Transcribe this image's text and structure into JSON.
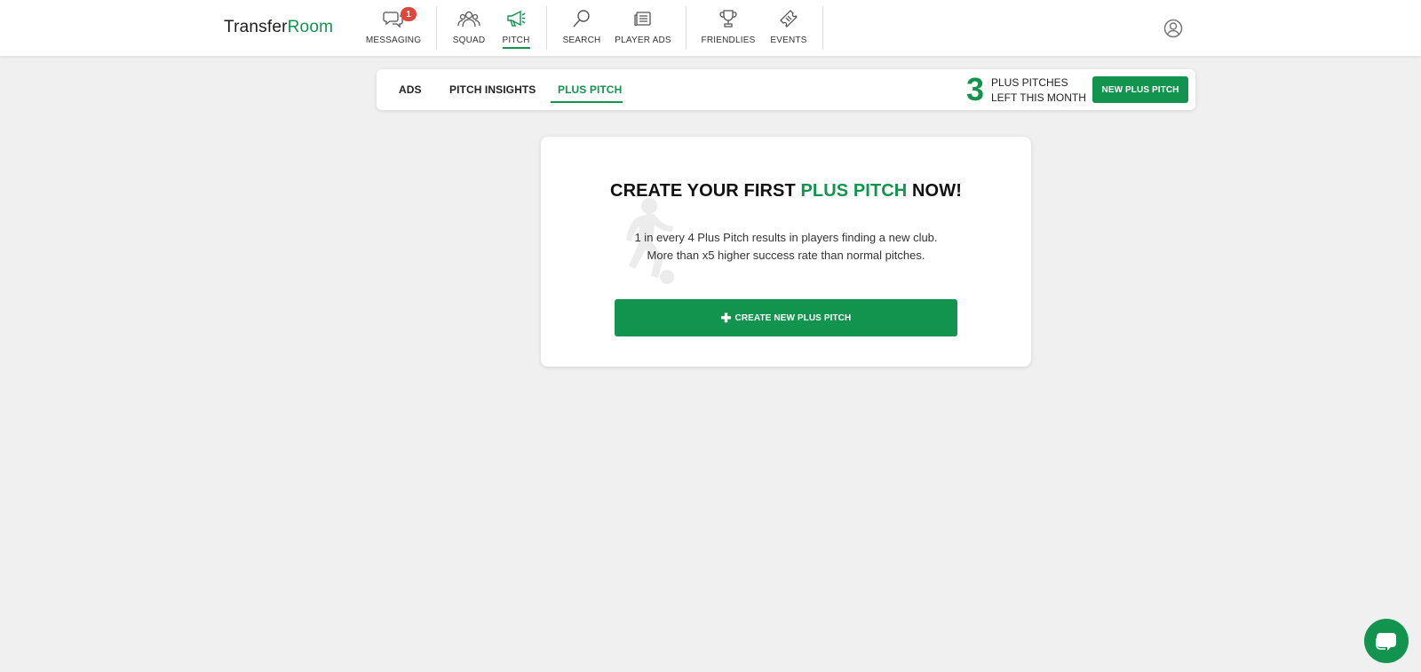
{
  "logo": {
    "part1": "Transfer",
    "part2": "Room"
  },
  "nav": {
    "messaging": "MESSAGING",
    "messaging_badge": "1",
    "squad": "SQUAD",
    "pitch": "PITCH",
    "search": "SEARCH",
    "player_ads": "PLAYER ADS",
    "friendlies": "FRIENDLIES",
    "events": "EVENTS"
  },
  "subnav": {
    "tabs": [
      {
        "label": "ADS"
      },
      {
        "label": "PITCH INSIGHTS"
      },
      {
        "label": "PLUS PITCH"
      }
    ],
    "active_tab": "PLUS PITCH",
    "pitches_left": "3",
    "pitches_left_line1": "PLUS PITCHES",
    "pitches_left_line2": "LEFT THIS MONTH",
    "new_button": "NEW PLUS PITCH"
  },
  "card": {
    "title_part1": "CREATE YOUR FIRST ",
    "title_highlight": "PLUS PITCH",
    "title_part2": " NOW!",
    "desc_line1": "1 in every 4 Plus Pitch results in players finding a new club.",
    "desc_line2": "More than x5 higher success rate than normal pitches.",
    "create_button": "CREATE NEW PLUS PITCH"
  },
  "colors": {
    "accent": "#12944f",
    "badge": "#e0473a",
    "background": "#f0f0f0"
  },
  "icons": [
    "chat-bubbles-icon",
    "people-icon",
    "megaphone-icon",
    "magnifier-icon",
    "newspaper-icon",
    "trophy-icon",
    "ticket-icon",
    "user-circle-icon",
    "plus-icon",
    "chat-icon",
    "football-player-icon"
  ]
}
